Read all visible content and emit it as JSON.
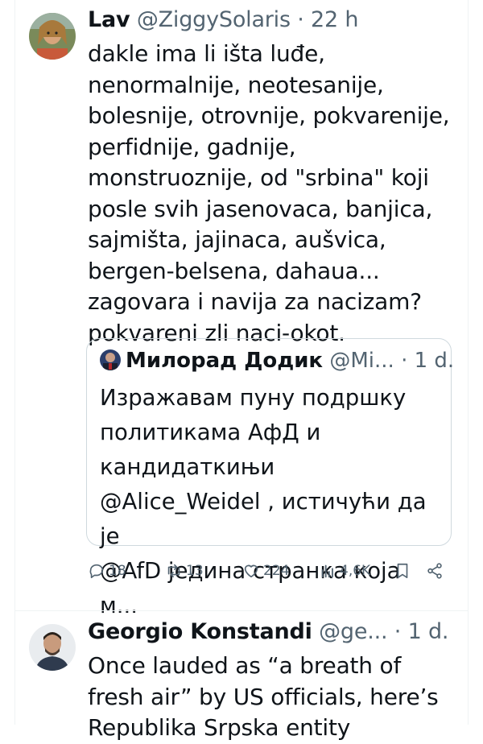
{
  "tweet1": {
    "name": "Lav",
    "handle": "@ZiggySolaris",
    "sep": "·",
    "time": "22 h",
    "text": "dakle ima li išta luđe,\nnenormalnije, neotesanije,\nbolesnije, otrovnije, pokvarenije,\nperfidnije, gadnije,\nmonstruoznije, od \"srbina\" koji\nposle svih jasenovaca, banjica,\nsajmišta, jajinaca, aušvica,\nbergen-belsena, dahaua...\nzagovara i navija za nacizam?\npokvareni zli naci-okot.",
    "quote": {
      "name": "Милорад Додик",
      "handle": "@Mi...",
      "sep": "·",
      "time": "1 d.",
      "text": "Изражавам пуну подршку\nполитикама АфД и\nкандидаткињи\n@Alice_Weidel , истичући да је\n@AfD једина странка која м..."
    },
    "actions": {
      "replies": "18",
      "retweets": "13",
      "likes": "224",
      "views": "4,6K"
    }
  },
  "tweet2": {
    "name": "Georgio Konstandi",
    "handle": "@ge...",
    "sep": "·",
    "time": "1 d.",
    "text": "Once lauded as “a breath of\nfresh air” by US officials, here’s\nRepublika Srpska entity"
  },
  "colors": {
    "text": "#0f1419",
    "secondary": "#536471",
    "border": "#cfd9de"
  }
}
